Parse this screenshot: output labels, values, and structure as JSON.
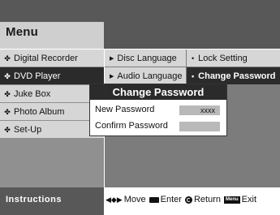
{
  "header": {
    "title": "Menu"
  },
  "menu": {
    "items": [
      {
        "label": "Digital Recorder",
        "selected": false
      },
      {
        "label": "DVD Player",
        "selected": true
      },
      {
        "label": "Juke Box",
        "selected": false
      },
      {
        "label": "Photo Album",
        "selected": false
      },
      {
        "label": "Set-Up",
        "selected": false
      }
    ]
  },
  "submenu": {
    "items": [
      {
        "label": "Disc Language"
      },
      {
        "label": "Audio Language"
      }
    ]
  },
  "submenu2": {
    "items": [
      {
        "label": "Lock Setting",
        "selected": false
      },
      {
        "label": "Change Password",
        "selected": true
      }
    ]
  },
  "dialog": {
    "title": "Change Password",
    "new_password_label": "New Password",
    "new_password_value": "xxxx",
    "confirm_password_label": "Confirm Password",
    "confirm_password_value": ""
  },
  "footer": {
    "title": "Instructions",
    "hints": {
      "move": "Move",
      "enter": "Enter",
      "return": "Return",
      "menu_badge": "Menu",
      "exit": "Exit"
    }
  },
  "icons": {
    "menu_bullet": "gear-icon",
    "submenu_arrow": "triangle-right-icon",
    "submenu2_bullet": "dot-icon"
  },
  "colors": {
    "selected_bg": "#2b2b2b",
    "item_bg": "#d6d6d6",
    "header_bg": "#585858"
  }
}
